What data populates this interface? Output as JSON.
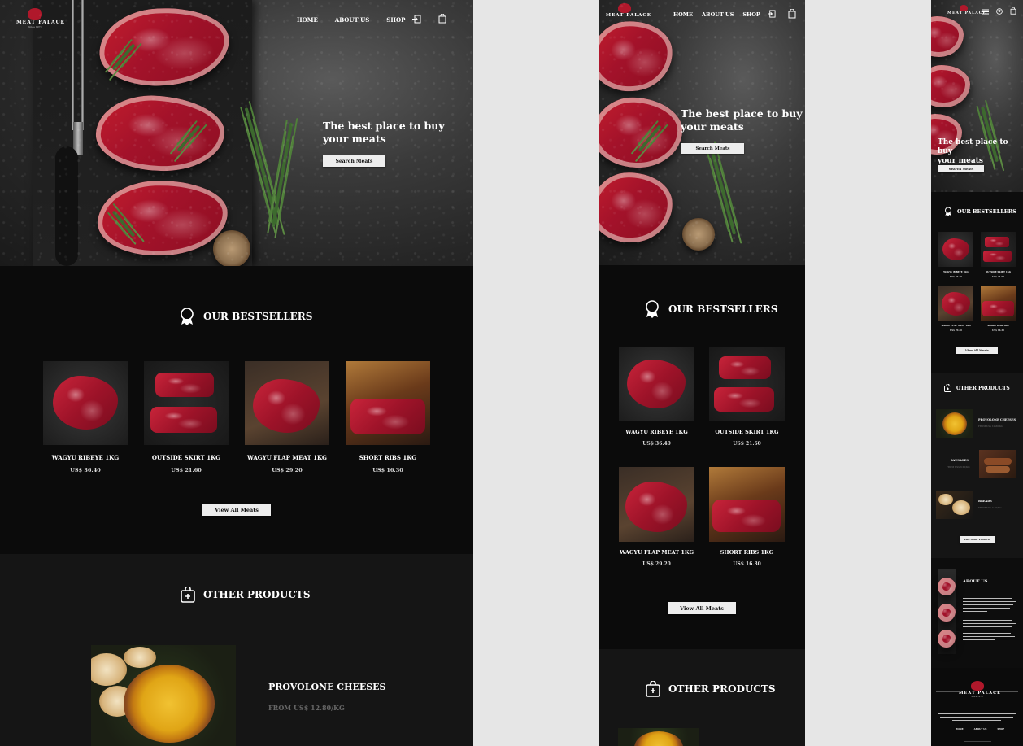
{
  "brand": {
    "name": "MEAT PALACE",
    "since": "Since 1970",
    "brand_color": "#b0182b"
  },
  "nav": {
    "home": "HOME",
    "about": "ABOUT US",
    "shop": "SHOP",
    "login_icon": "login-icon",
    "cart_icon": "shopping-bag-icon",
    "menu_icon": "hamburger-menu-icon",
    "user_icon": "user-icon"
  },
  "hero": {
    "title_line1": "The best place to buy",
    "title_line2": "your meats",
    "button": "Search Meats"
  },
  "bestsellers": {
    "title": "OUR BESTSELLERS",
    "icon": "award-ribbon-icon",
    "products": [
      {
        "name": "WAGYU RIBEYE 1KG",
        "price": "US$ 36.40"
      },
      {
        "name": "OUTSIDE SKIRT 1KG",
        "price": "US$ 21.60"
      },
      {
        "name": "WAGYU FLAP MEAT 1KG",
        "price": "US$ 29.20"
      },
      {
        "name": "SHORT RIBS 1KG",
        "price": "US$ 16.30"
      }
    ],
    "button": "View All Meats"
  },
  "other_products": {
    "title": "OTHER PRODUCTS",
    "icon": "shopping-bag-plus-icon",
    "items": [
      {
        "name": "PROVOLONE CHEESES",
        "price": "FROM US$ 12.80/KG"
      },
      {
        "name": "SAUSAGES",
        "price": "FROM US$ 9.90/KG"
      },
      {
        "name": "BREADS",
        "price": "FROM US$ 4.50/KG"
      }
    ],
    "button": "View Other Products"
  },
  "about": {
    "title": "ABOUT US"
  },
  "footer": {
    "links": [
      "HOME",
      "ABOUT US",
      "SHOP"
    ]
  },
  "colors": {
    "page_bg": "#e6e6e6",
    "section_dark": "#0b0b0b",
    "section_mid": "#151515",
    "button_bg": "#ededed",
    "price_muted": "#666666"
  }
}
